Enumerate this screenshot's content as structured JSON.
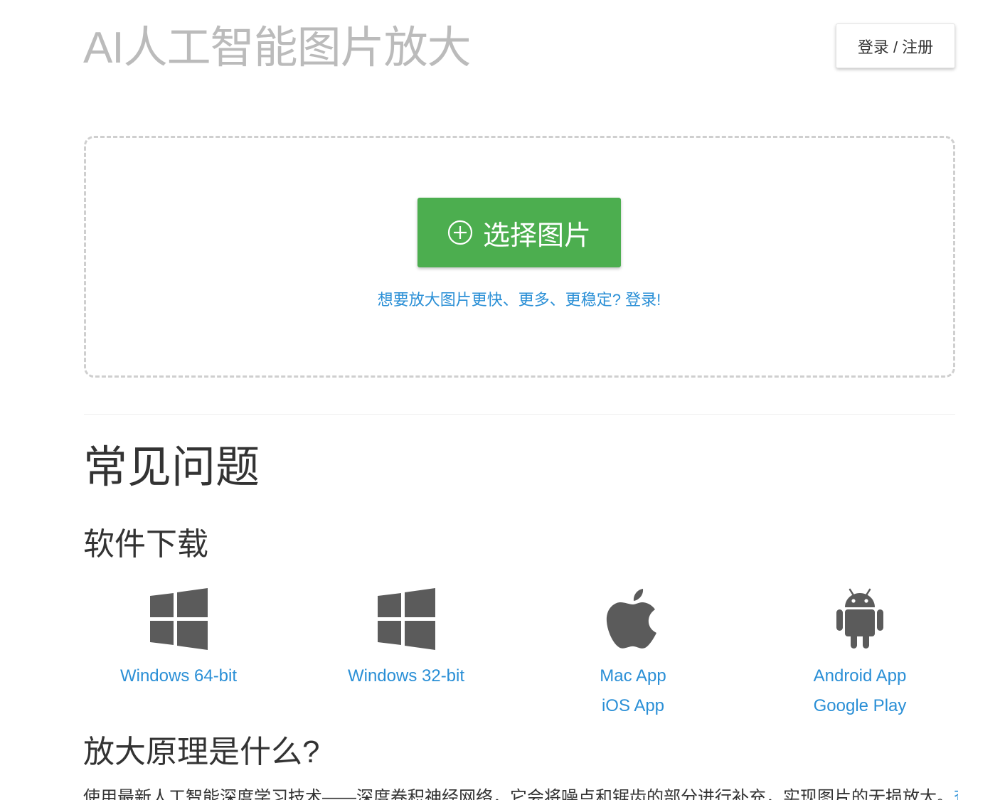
{
  "header": {
    "title": "AI人工智能图片放大",
    "login_label": "登录 / 注册"
  },
  "upload": {
    "select_label": "选择图片",
    "hint": "想要放大图片更快、更多、更稳定? 登录!"
  },
  "faq": {
    "title": "常见问题",
    "downloads": {
      "title": "软件下载",
      "items": [
        {
          "icon": "windows-icon",
          "links": [
            "Windows 64-bit"
          ]
        },
        {
          "icon": "windows-icon",
          "links": [
            "Windows 32-bit"
          ]
        },
        {
          "icon": "apple-icon",
          "links": [
            "Mac App",
            "iOS App"
          ]
        },
        {
          "icon": "android-icon",
          "links": [
            "Android App",
            "Google Play"
          ]
        }
      ]
    },
    "principle": {
      "title": "放大原理是什么?",
      "text": "使用最新人工智能深度学习技术——深度卷积神经网络，它会将噪点和锯齿的部分进行补充，实现图片的无损放大。",
      "more": "查看"
    }
  },
  "colors": {
    "accent_green": "#4cae4f",
    "link_blue": "#2a8fd6",
    "icon_gray": "#5b5b5b"
  }
}
